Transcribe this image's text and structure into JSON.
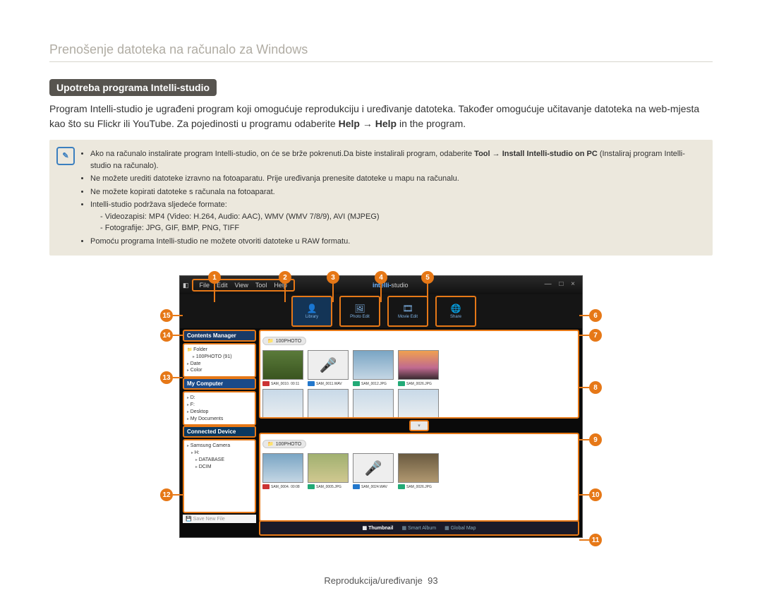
{
  "doc_title": "Prenošenje datoteka na računalo za Windows",
  "section_badge": "Upotreba programa Intelli-studio",
  "intro": "Program Intelli-studio je ugrađeni program koji omogućuje reprodukciju i uređivanje datoteka. Također omogućuje učitavanje datoteka na web-mjesta kao što su Flickr ili YouTube. Za pojedinosti u programu odaberite ",
  "intro_bold1": "Help",
  "intro_arrow": " → ",
  "intro_bold2": "Help",
  "intro_tail": " in the program.",
  "notes": {
    "b1a": "Ako na računalo instalirate program Intelli-studio, on će se brže pokrenuti.Da biste instalirali program, odaberite ",
    "b1_tool": "Tool",
    "b1_arrow": " → ",
    "b1_install": "Install Intelli-studio on PC",
    "b1_tail": " (Instaliraj program Intelli-studio na računalo).",
    "b2": "Ne možete urediti datoteke izravno na fotoaparatu. Prije uređivanja prenesite datoteke u mapu na računalu.",
    "b3": "Ne možete kopirati datoteke s računala na fotoaparat.",
    "b4": "Intelli-studio podržava sljedeće formate:",
    "b4a": "Videozapisi: MP4 (Video: H.264, Audio: AAC), WMV (WMV 7/8/9), AVI (MJPEG)",
    "b4b": "Fotografije: JPG, GIF, BMP, PNG, TIFF",
    "b5": "Pomoću programa Intelli-studio ne možete otvoriti datoteke u RAW formatu."
  },
  "ui": {
    "menus": [
      "File",
      "Edit",
      "View",
      "Tool",
      "Help"
    ],
    "logo_pre": "intelli-",
    "logo_suf": "studio",
    "modes": {
      "library": "Library",
      "photo": "Photo Edit",
      "movie": "Movie Edit",
      "share": "Share"
    },
    "cm_head": "Contents Manager",
    "cm_folder": "Folder",
    "cm_100p": "100PHOTO",
    "cm_100p_count": "(91)",
    "cm_date": "Date",
    "cm_color": "Color",
    "mycomp": "My Computer",
    "drives": [
      "D:",
      "F:",
      "Desktop",
      "My Documents"
    ],
    "conn": "Connected Device",
    "conn_items": [
      "Samsung Camera",
      "H:",
      "DATABASE",
      "DCIM"
    ],
    "save": "Save New File",
    "crumb": "100PHOTO",
    "thumbs_top": [
      {
        "badge": "b1",
        "name": "SAM_0010.",
        "extra": "00:11"
      },
      {
        "badge": "b3",
        "name": "SAM_0011.WAV"
      },
      {
        "badge": "b2",
        "name": "SAM_0012.JPG"
      },
      {
        "badge": "b2",
        "name": "SAM_0026.JPG"
      }
    ],
    "thumbs_bot": [
      {
        "badge": "b1",
        "name": "SAM_0004.",
        "extra": "00:08"
      },
      {
        "badge": "b2",
        "name": "SAM_0005.JPG"
      },
      {
        "badge": "b3",
        "name": "SAM_0024.WAV"
      },
      {
        "badge": "b2",
        "name": "SAM_0026.JPG"
      }
    ],
    "foot": {
      "thumb": "Thumbnail",
      "smart": "Smart Album",
      "map": "Global Map"
    }
  },
  "callouts": [
    "1",
    "2",
    "3",
    "4",
    "5",
    "6",
    "7",
    "8",
    "9",
    "10",
    "11",
    "12",
    "13",
    "14",
    "15"
  ],
  "footer_label": "Reprodukcija/uređivanje",
  "footer_page": "93"
}
